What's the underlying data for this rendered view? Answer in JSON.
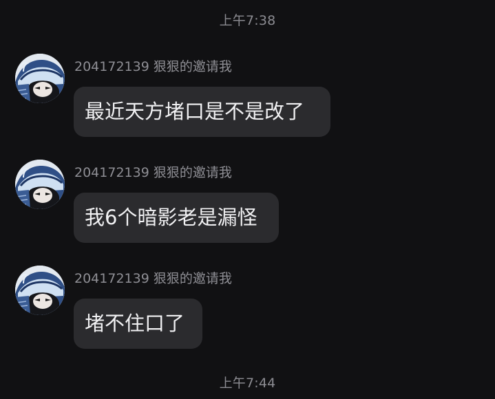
{
  "timestamps": {
    "top": "上午7:38",
    "bottom": "上午7:44"
  },
  "messages": [
    {
      "sender": "204172139 狠狠的邀请我",
      "text": "最近天方堵口是不是改了"
    },
    {
      "sender": "204172139 狠狠的邀请我",
      "text": "我6个暗影老是漏怪"
    },
    {
      "sender": "204172139 狠狠的邀请我",
      "text": "堵不住口了"
    }
  ],
  "avatar": {
    "icon": "anime-character-avatar-icon"
  },
  "colors": {
    "background": "#111113",
    "bubble": "#2b2b2e",
    "secondary_text": "#8e8e94",
    "primary_text": "#f1f1f3"
  }
}
